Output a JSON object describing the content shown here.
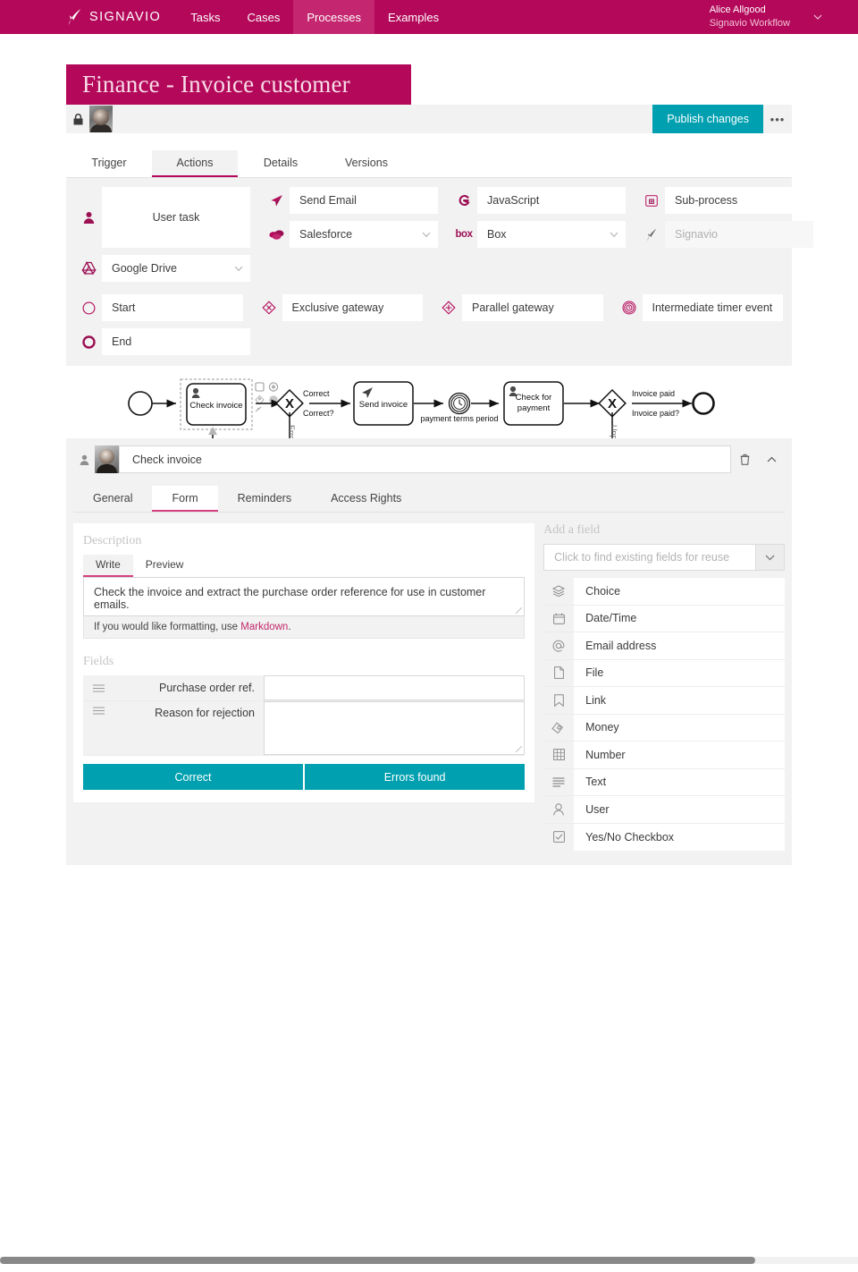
{
  "topnav": {
    "brand": "SIGNAVIO",
    "items": [
      {
        "label": "Tasks",
        "active": false
      },
      {
        "label": "Cases",
        "active": false
      },
      {
        "label": "Processes",
        "active": true
      },
      {
        "label": "Examples",
        "active": false
      }
    ],
    "user": {
      "name": "Alice Allgood",
      "org": "Signavio Workflow"
    }
  },
  "page": {
    "title": "Finance - Invoice customer",
    "toolbar": {
      "publish_label": "Publish changes",
      "more_label": "•••"
    },
    "tabs": [
      {
        "label": "Trigger",
        "active": false
      },
      {
        "label": "Actions",
        "active": true
      },
      {
        "label": "Details",
        "active": false
      },
      {
        "label": "Versions",
        "active": false
      }
    ]
  },
  "palette": {
    "user_task": "User task",
    "google_drive": "Google Drive",
    "send_email": "Send Email",
    "salesforce": "Salesforce",
    "javascript": "JavaScript",
    "box": "Box",
    "sub_process": "Sub-process",
    "signavio": "Signavio",
    "start": "Start",
    "end": "End",
    "exclusive_gateway": "Exclusive gateway",
    "parallel_gateway": "Parallel gateway",
    "intermediate_timer_event": "Intermediate timer event"
  },
  "diagram": {
    "nodes": {
      "check_invoice": "Check invoice",
      "send_invoice": "Send invoice",
      "check_for_payment": "Check for payment",
      "gateway1": "X",
      "gateway2": "X"
    },
    "labels": {
      "correct_flow": "Correct",
      "gateway1_name": "Correct?",
      "errors_found": "Errors found",
      "payment_terms_period": "payment terms period",
      "invoice_paid_flow": "Invoice paid",
      "gateway2_name": "Invoice paid?",
      "unpaid": "Unpaid"
    }
  },
  "detail": {
    "task_name": "Check invoice",
    "tabs": [
      {
        "label": "General",
        "active": false
      },
      {
        "label": "Form",
        "active": true
      },
      {
        "label": "Reminders",
        "active": false
      },
      {
        "label": "Access Rights",
        "active": false
      }
    ],
    "description": {
      "section_label": "Description",
      "write_tab": "Write",
      "preview_tab": "Preview",
      "text": "Check the invoice and extract the purchase order reference for use in customer emails.",
      "hint_prefix": "If you would like formatting, use ",
      "hint_link": "Markdown",
      "hint_suffix": "."
    },
    "fields": {
      "section_label": "Fields",
      "rows": [
        {
          "label": "Purchase order ref.",
          "value": "",
          "multiline": false
        },
        {
          "label": "Reason for rejection",
          "value": "",
          "multiline": true
        }
      ],
      "buttons": [
        {
          "label": "Correct"
        },
        {
          "label": "Errors found"
        }
      ]
    },
    "add_field": {
      "section_label": "Add a field",
      "reuse_placeholder": "Click to find existing fields for reuse",
      "types": [
        {
          "label": "Choice",
          "icon": "layers-icon"
        },
        {
          "label": "Date/Time",
          "icon": "calendar-icon"
        },
        {
          "label": "Email address",
          "icon": "at-icon"
        },
        {
          "label": "File",
          "icon": "file-icon"
        },
        {
          "label": "Link",
          "icon": "bookmark-icon"
        },
        {
          "label": "Money",
          "icon": "money-icon"
        },
        {
          "label": "Number",
          "icon": "grid-icon"
        },
        {
          "label": "Text",
          "icon": "text-lines-icon"
        },
        {
          "label": "User",
          "icon": "user-icon"
        },
        {
          "label": "Yes/No Checkbox",
          "icon": "checkbox-icon"
        }
      ]
    }
  },
  "colors": {
    "brand": "#b4095a",
    "accent_teal": "#00a0b0",
    "tab_underline": "#d6417f",
    "icon_magenta": "#9c1054"
  }
}
